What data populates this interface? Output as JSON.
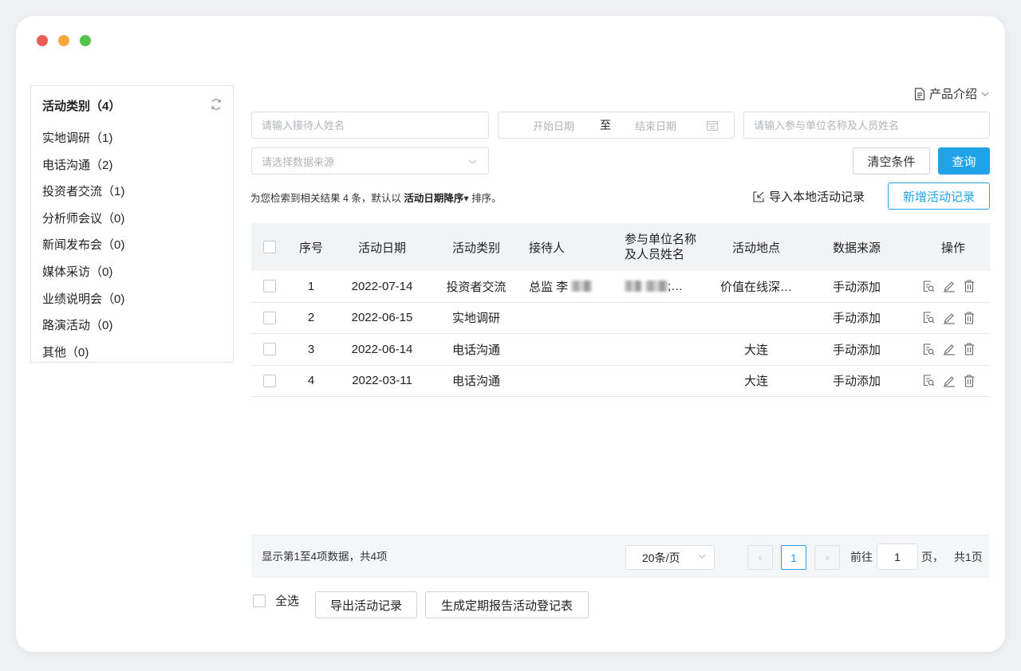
{
  "window": {
    "dot_colors": [
      "#ec5d56",
      "#f4a83b",
      "#52c24a"
    ]
  },
  "sidebar": {
    "header": "活动类别（4）",
    "items": [
      {
        "label": "实地调研（1)"
      },
      {
        "label": "电话沟通（2)"
      },
      {
        "label": "投资者交流（1)"
      },
      {
        "label": "分析师会议（0)"
      },
      {
        "label": "新闻发布会（0)"
      },
      {
        "label": "媒体采访（0)"
      },
      {
        "label": "业绩说明会（0)"
      },
      {
        "label": "路演活动（0)"
      },
      {
        "label": "其他（0)"
      }
    ]
  },
  "header": {
    "product_intro": "产品介绍"
  },
  "filters": {
    "receiver_placeholder": "请输入接待人姓名",
    "start_date_placeholder": "开始日期",
    "date_separator": "至",
    "end_date_placeholder": "结束日期",
    "participants_placeholder": "请输入参与单位名称及人员姓名",
    "source_placeholder": "请选择数据来源",
    "clear_label": "清空条件",
    "query_label": "查询"
  },
  "result": {
    "prefix": "为您检索到相关结果 4 条，默认以",
    "sort_field": "活动日期降序",
    "sort_arrow": "▾",
    "suffix": "排序。"
  },
  "actions": {
    "import_label": "导入本地活动记录",
    "add_label": "新增活动记录"
  },
  "table": {
    "columns": [
      "序号",
      "活动日期",
      "活动类别",
      "接待人",
      "参与单位名称",
      "及人员姓名",
      "活动地点",
      "数据来源",
      "操作"
    ],
    "rows": [
      {
        "index": "1",
        "date": "2022-07-14",
        "category": "投资者交流",
        "receiver": "总监 李",
        "participants": ";…",
        "location": "价值在线深…",
        "source": "手动添加"
      },
      {
        "index": "2",
        "date": "2022-06-15",
        "category": "实地调研",
        "receiver": "",
        "participants": "",
        "location": "",
        "source": "手动添加"
      },
      {
        "index": "3",
        "date": "2022-06-14",
        "category": "电话沟通",
        "receiver": "",
        "participants": "",
        "location": "大连",
        "source": "手动添加"
      },
      {
        "index": "4",
        "date": "2022-03-11",
        "category": "电话沟通",
        "receiver": "",
        "participants": "",
        "location": "大连",
        "source": "手动添加"
      }
    ]
  },
  "pagination": {
    "info": "显示第1至4项数据，共4项",
    "page_size": "20条/页",
    "prev": "‹",
    "current_page": "1",
    "next": "›",
    "goto_label": "前往",
    "goto_value": "1",
    "page_unit": "页，",
    "total_pages": "共1页"
  },
  "footer": {
    "select_all": "全选",
    "export_label": "导出活动记录",
    "generate_label": "生成定期报告活动登记表"
  },
  "colors": {
    "accent": "#21a3e8",
    "header_bg": "#f2f3f5"
  }
}
